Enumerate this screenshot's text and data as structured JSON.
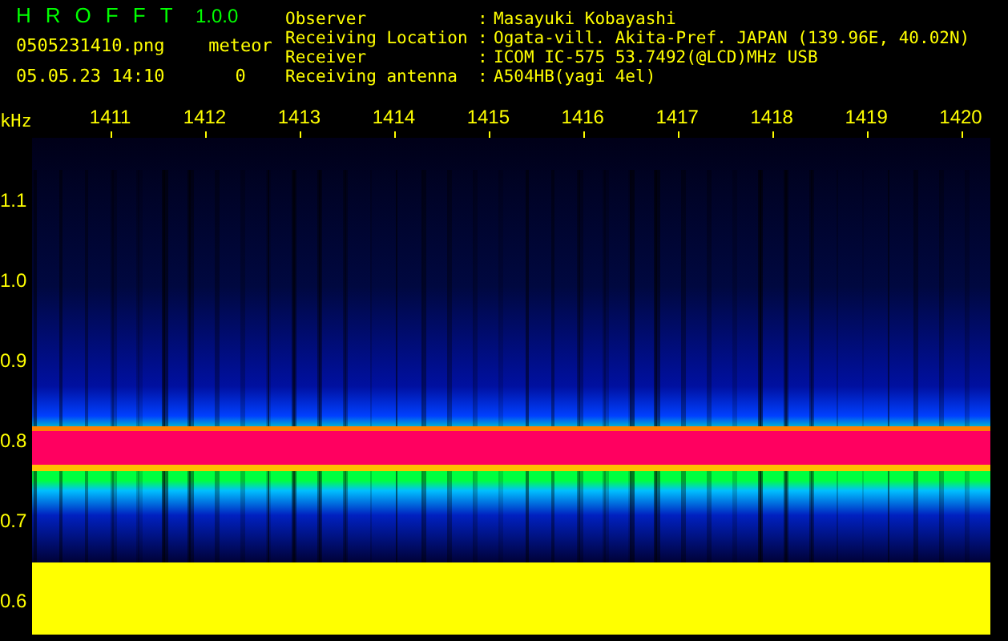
{
  "app": {
    "name_letters": [
      "H",
      "R",
      "O",
      "F",
      "F",
      "T"
    ],
    "version": "1.0.0",
    "file": "0505231410.png",
    "timestamp": "05.05.23 14:10",
    "counter": {
      "label": "meteor",
      "value": "0"
    }
  },
  "info": [
    {
      "label": "Observer",
      "separator": ":",
      "value": "Masayuki Kobayashi"
    },
    {
      "label": "Receiving Location",
      "separator": ":",
      "value": "Ogata-vill. Akita-Pref. JAPAN (139.96E, 40.02N)"
    },
    {
      "label": "Receiver",
      "separator": ":",
      "value": "ICOM IC-575 53.7492(@LCD)MHz USB"
    },
    {
      "label": "Receiving antenna",
      "separator": ":",
      "value": "A504HB(yagi 4el)"
    }
  ],
  "plot": {
    "axis_unit": "kHz",
    "top_labels": [
      "1411",
      "1412",
      "1413",
      "1414",
      "1415",
      "1416",
      "1417",
      "1418",
      "1419",
      "1420"
    ],
    "left_labels": [
      "1.1",
      "1.0",
      "0.9",
      "0.8",
      "0.7",
      "0.6"
    ]
  }
}
